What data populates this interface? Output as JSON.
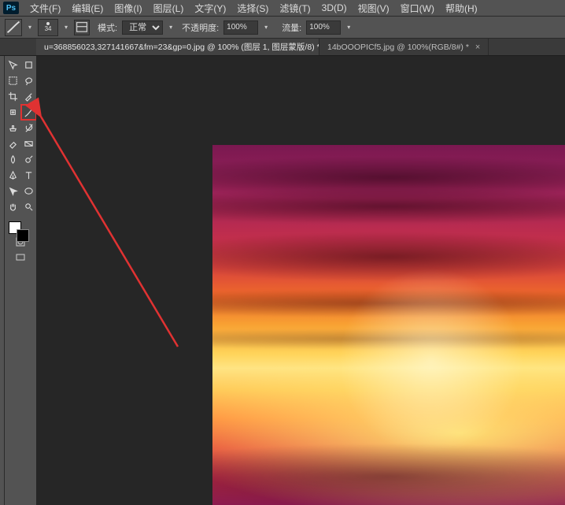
{
  "app": {
    "badge": "Ps"
  },
  "menu": {
    "items": [
      "文件(F)",
      "编辑(E)",
      "图像(I)",
      "图层(L)",
      "文字(Y)",
      "选择(S)",
      "滤镜(T)",
      "3D(D)",
      "视图(V)",
      "窗口(W)",
      "帮助(H)"
    ]
  },
  "options": {
    "brush_size": "34",
    "mode_label": "模式:",
    "mode_value": "正常",
    "opacity_label": "不透明度:",
    "opacity_value": "100%",
    "flow_label": "流量:",
    "flow_value": "100%"
  },
  "tabs": {
    "items": [
      {
        "label": "u=368856023,327141667&fm=23&gp=0.jpg @ 100% (图层 1, 图层蒙版/8) *",
        "active": true
      },
      {
        "label": "14bOOOPICf5.jpg @ 100%(RGB/8#) *",
        "active": false
      }
    ]
  },
  "tools": {
    "names": [
      "move",
      "artboard",
      "marquee",
      "lasso",
      "crop",
      "eyedropper",
      "spot-heal",
      "brush",
      "clone",
      "history-brush",
      "eraser",
      "gradient",
      "blur",
      "dodge",
      "pen",
      "type",
      "path-select",
      "shape",
      "hand",
      "zoom"
    ],
    "highlighted_index": 7
  },
  "colors": {
    "foreground": "#ffffff",
    "background": "#000000"
  },
  "annotation": {
    "type": "arrow",
    "target_tool": "brush"
  }
}
